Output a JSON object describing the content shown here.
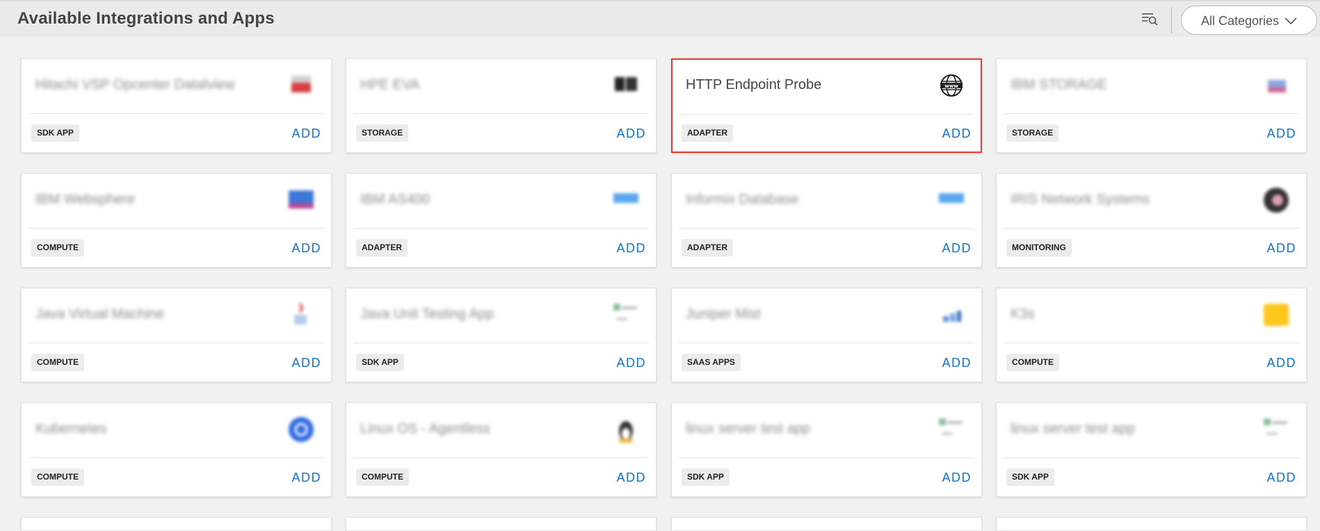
{
  "header": {
    "title": "Available Integrations and Apps",
    "filter_icon": "filter-search-icon",
    "category_select": {
      "value": "All Categories",
      "icon": "chevron-down-icon"
    }
  },
  "colors": {
    "accent": "#1173c9",
    "selected_border": "#e53935",
    "badge_bg": "#ececec"
  },
  "cards": [
    {
      "name": "Hitachi VSP Opcenter Datalview",
      "badge": "SDK APP",
      "add": "ADD",
      "logo": "hitachi-logo",
      "blurred": true
    },
    {
      "name": "HPE EVA",
      "badge": "STORAGE",
      "add": "ADD",
      "logo": "hpe-storage-logo",
      "blurred": true
    },
    {
      "name": "HTTP Endpoint Probe",
      "badge": "ADAPTER",
      "add": "ADD",
      "logo": "globe-www-icon",
      "blurred": false,
      "selected": true
    },
    {
      "name": "IBM STORAGE",
      "badge": "STORAGE",
      "add": "ADD",
      "logo": "ibm-storage-logo",
      "blurred": true
    },
    {
      "name": "IBM Websphere",
      "badge": "COMPUTE",
      "add": "ADD",
      "logo": "ibm-websphere-logo",
      "blurred": true
    },
    {
      "name": "IBM AS400",
      "badge": "ADAPTER",
      "add": "ADD",
      "logo": "ibm-logo",
      "blurred": true
    },
    {
      "name": "Informix Database",
      "badge": "ADAPTER",
      "add": "ADD",
      "logo": "ibm-logo",
      "blurred": true
    },
    {
      "name": "IRIS Network Systems",
      "badge": "MONITORING",
      "add": "ADD",
      "logo": "iris-logo",
      "blurred": true
    },
    {
      "name": "Java Virtual Machine",
      "badge": "COMPUTE",
      "add": "ADD",
      "logo": "java-logo",
      "blurred": true
    },
    {
      "name": "Java Unit Testing App",
      "badge": "SDK APP",
      "add": "ADD",
      "logo": "broken-image-icon",
      "blurred": true
    },
    {
      "name": "Juniper Mist",
      "badge": "SAAS APPS",
      "add": "ADD",
      "logo": "juniper-mist-logo",
      "blurred": true
    },
    {
      "name": "K3s",
      "badge": "COMPUTE",
      "add": "ADD",
      "logo": "k3s-logo",
      "blurred": true
    },
    {
      "name": "Kubernetes",
      "badge": "COMPUTE",
      "add": "ADD",
      "logo": "kubernetes-logo",
      "blurred": true
    },
    {
      "name": "Linux OS - Agentless",
      "badge": "COMPUTE",
      "add": "ADD",
      "logo": "linux-tux-logo",
      "blurred": true
    },
    {
      "name": "linux server test app",
      "badge": "SDK APP",
      "add": "ADD",
      "logo": "broken-image-icon",
      "blurred": true
    },
    {
      "name": "linux server test app",
      "badge": "SDK APP",
      "add": "ADD",
      "logo": "broken-image-icon",
      "blurred": true
    }
  ]
}
